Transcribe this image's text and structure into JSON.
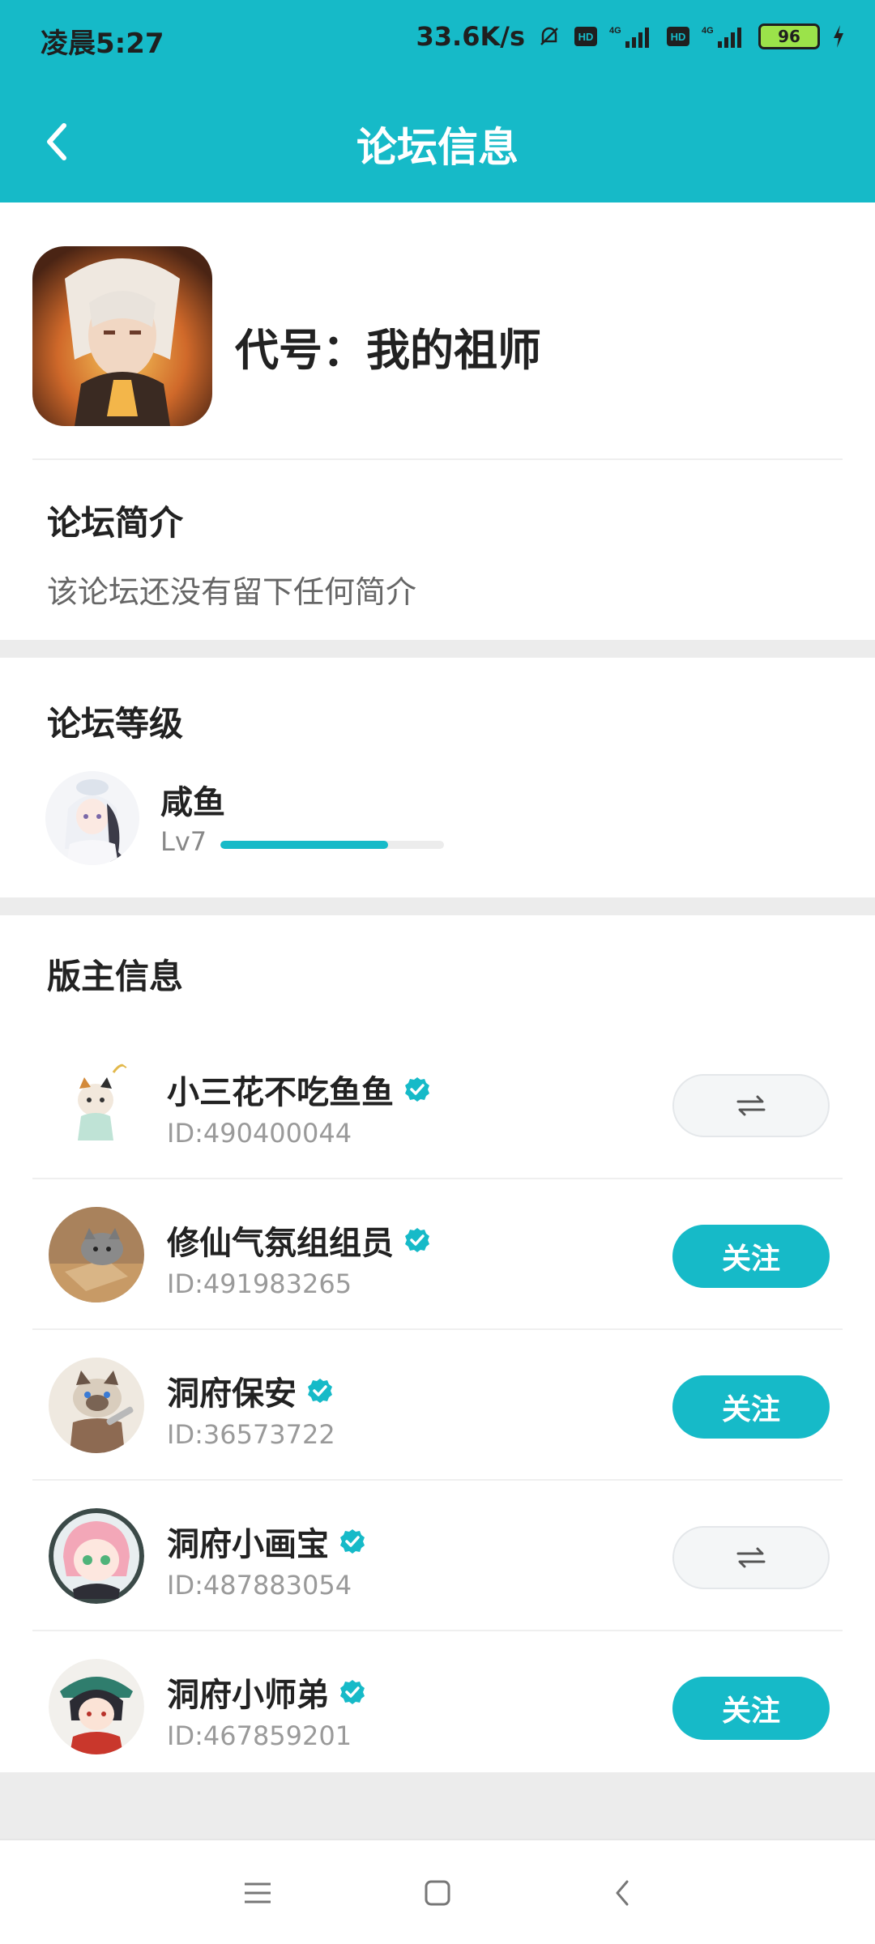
{
  "status_bar": {
    "time": "凌晨5:27",
    "speed": "33.6K/s",
    "battery": "96"
  },
  "header": {
    "title": "论坛信息"
  },
  "forum": {
    "name": "代号：我的祖师",
    "intro_title": "论坛简介",
    "intro_text": "该论坛还没有留下任何简介"
  },
  "level": {
    "title": "论坛等级",
    "name": "咸鱼",
    "lv": "Lv7",
    "progress": 0.75
  },
  "moderators": {
    "title": "版主信息",
    "items": [
      {
        "name": "小三花不吃鱼鱼",
        "id": "ID:490400044",
        "status": "mutual"
      },
      {
        "name": "修仙气氛组组员",
        "id": "ID:491983265",
        "status": "follow",
        "follow_label": "关注"
      },
      {
        "name": "洞府保安",
        "id": "ID:36573722",
        "status": "follow",
        "follow_label": "关注"
      },
      {
        "name": "洞府小画宝",
        "id": "ID:487883054",
        "status": "mutual"
      },
      {
        "name": "洞府小师弟",
        "id": "ID:467859201",
        "status": "follow",
        "follow_label": "关注"
      }
    ]
  },
  "colors": {
    "accent": "#16bac8",
    "background": "#ececec",
    "text_primary": "#222222",
    "text_secondary": "#9a9a9a"
  },
  "icons": {
    "back": "chevron-left-icon",
    "verified": "verified-badge-icon",
    "mutual": "mutual-follow-icon",
    "nav_menu": "menu-icon",
    "nav_home": "square-home-icon",
    "nav_back": "chevron-left-icon"
  }
}
